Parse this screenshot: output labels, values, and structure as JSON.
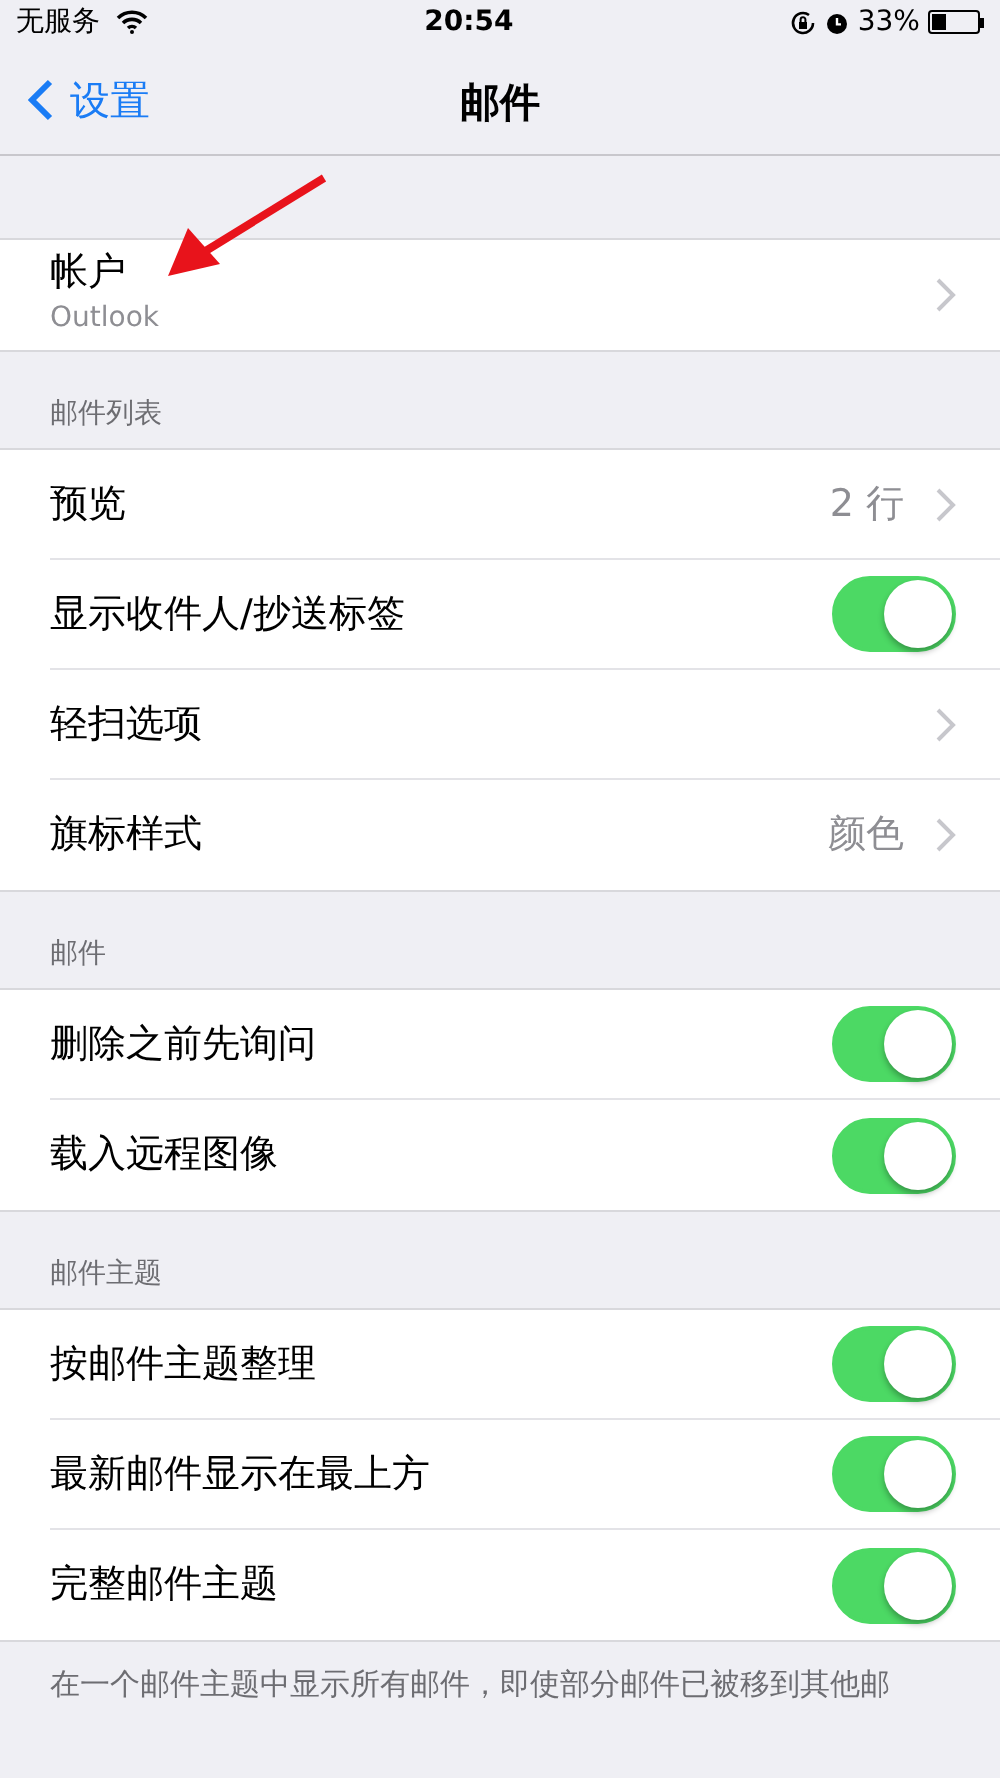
{
  "status_bar": {
    "carrier": "无服务",
    "time": "20:54",
    "battery": "33%"
  },
  "nav": {
    "back": "设置",
    "title": "邮件"
  },
  "account": {
    "title": "帐户",
    "subtitle": "Outlook"
  },
  "sections": [
    {
      "header": "邮件列表",
      "rows": [
        {
          "kind": "detail",
          "label": "预览",
          "value": "2 行"
        },
        {
          "kind": "toggle",
          "label": "显示收件人/抄送标签",
          "on": true
        },
        {
          "kind": "link",
          "label": "轻扫选项"
        },
        {
          "kind": "detail",
          "label": "旗标样式",
          "value": "颜色"
        }
      ]
    },
    {
      "header": "邮件",
      "rows": [
        {
          "kind": "toggle",
          "label": "删除之前先询问",
          "on": true
        },
        {
          "kind": "toggle",
          "label": "载入远程图像",
          "on": true
        }
      ]
    },
    {
      "header": "邮件主题",
      "rows": [
        {
          "kind": "toggle",
          "label": "按邮件主题整理",
          "on": true
        },
        {
          "kind": "toggle",
          "label": "最新邮件显示在最上方",
          "on": true
        },
        {
          "kind": "toggle",
          "label": "完整邮件主题",
          "on": true
        }
      ]
    }
  ],
  "footer": "在一个邮件主题中显示所有邮件，即使部分邮件已被移到其他邮"
}
